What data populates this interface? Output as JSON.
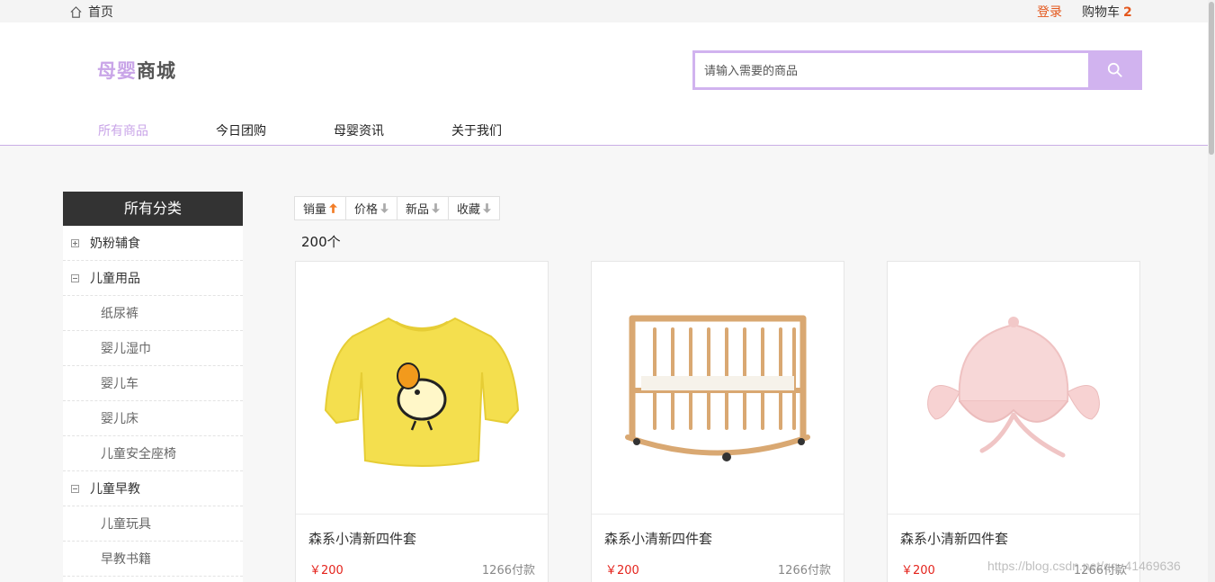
{
  "topbar": {
    "home_label": "首页",
    "login_label": "登录",
    "cart_label": "购物车",
    "cart_count": "2"
  },
  "header": {
    "logo_part1": "母婴",
    "logo_part2": "商城",
    "search_placeholder": "请输入需要的商品",
    "search_icon": "search-icon",
    "nav": [
      "所有商品",
      "今日团购",
      "母婴资讯",
      "关于我们"
    ],
    "nav_active": "所有商品"
  },
  "sidebar": {
    "title": "所有分类",
    "items": [
      {
        "label": "奶粉辅食",
        "type": "category",
        "icon": "plus-box-icon"
      },
      {
        "label": "儿童用品",
        "type": "category",
        "icon": "minus-box-icon"
      },
      {
        "label": "纸尿裤",
        "type": "sub"
      },
      {
        "label": "婴儿湿巾",
        "type": "sub"
      },
      {
        "label": "婴儿车",
        "type": "sub"
      },
      {
        "label": "婴儿床",
        "type": "sub"
      },
      {
        "label": "儿童安全座椅",
        "type": "sub"
      },
      {
        "label": "儿童早教",
        "type": "category",
        "icon": "minus-box-icon"
      },
      {
        "label": "儿童玩具",
        "type": "sub"
      },
      {
        "label": "早教书籍",
        "type": "sub"
      }
    ]
  },
  "sort": {
    "options": [
      {
        "label": "销量",
        "icon": "arrow-up-icon",
        "active": true
      },
      {
        "label": "价格",
        "icon": "arrow-down-icon",
        "active": false
      },
      {
        "label": "新品",
        "icon": "arrow-down-icon",
        "active": false
      },
      {
        "label": "收藏",
        "icon": "arrow-down-icon",
        "active": false
      }
    ],
    "count": "200个"
  },
  "products": [
    {
      "name": "森系小清新四件套",
      "price": "￥200",
      "sales": "1266付款",
      "image": "yellow-shirt-image"
    },
    {
      "name": "森系小清新四件套",
      "price": "￥200",
      "sales": "1266付款",
      "image": "wooden-crib-image"
    },
    {
      "name": "森系小清新四件套",
      "price": "￥200",
      "sales": "1266付款",
      "image": "pink-hat-image"
    }
  ],
  "watermark": "https://blog.csdn.net/qq_41469636",
  "colors": {
    "accent": "#d1b3ef",
    "price": "#e4231c",
    "login": "#e4571c"
  }
}
